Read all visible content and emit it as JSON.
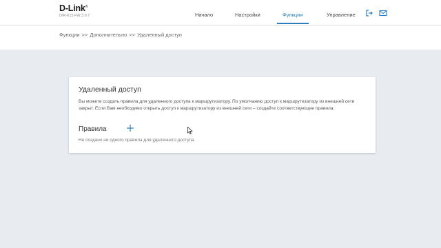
{
  "header": {
    "logo": "D-Link",
    "logo_mark": "®",
    "firmware": "DIR-615 FW:3.0.7",
    "nav": [
      {
        "label": "Начало"
      },
      {
        "label": "Настройки"
      },
      {
        "label": "Функции",
        "active": true
      },
      {
        "label": "Управление"
      }
    ],
    "accent_color": "#2b7fc0"
  },
  "breadcrumb": {
    "items": [
      "Функции",
      "Дополнительно",
      "Удаленный доступ"
    ],
    "separator": ">>"
  },
  "card": {
    "title": "Удаленный доступ",
    "description": "Вы можете создать правила для удаленного доступа к маршрутизатору. По умолчанию доступ к маршрутизатору из внешней сети закрыт. Если Вам необходимо открыть доступ к маршрутизатору из внешней сети – создайте соответствующие правила.",
    "rules_title": "Правила",
    "empty_note": "Не создано ни одного правила для удаленного доступа"
  },
  "icons": {
    "logout": "logout-icon",
    "mail": "mail-icon",
    "add": "plus-icon"
  }
}
